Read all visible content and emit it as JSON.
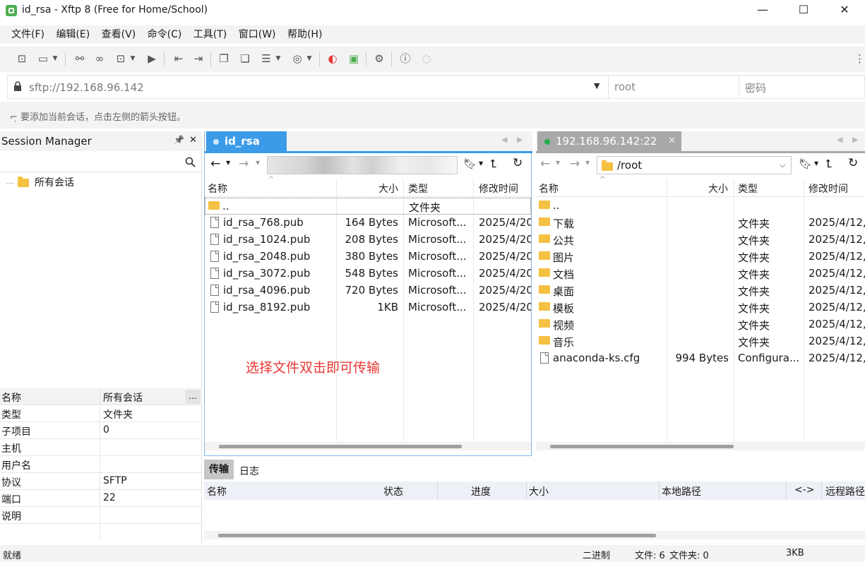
{
  "window": {
    "title": "id_rsa - Xftp 8 (Free for Home/School)",
    "minimize": "—",
    "maximize": "☐",
    "close": "✕"
  },
  "menu": [
    "文件(F)",
    "编辑(E)",
    "查看(V)",
    "命令(C)",
    "工具(T)",
    "窗口(W)",
    "帮助(H)"
  ],
  "address": {
    "url": "sftp://192.168.96.142",
    "user_placeholder": "root",
    "password_placeholder": "密码"
  },
  "hint": "要添加当前会话，点击左侧的箭头按钮。",
  "session_manager": {
    "title": "Session Manager",
    "pin": "📌",
    "close": "✕",
    "tree_root": "所有会话",
    "props_menu": "...",
    "properties": [
      {
        "k": "名称",
        "v": "所有会话"
      },
      {
        "k": "类型",
        "v": "文件夹"
      },
      {
        "k": "子项目",
        "v": "0"
      },
      {
        "k": "主机",
        "v": ""
      },
      {
        "k": "用户名",
        "v": ""
      },
      {
        "k": "协议",
        "v": "SFTP"
      },
      {
        "k": "端口",
        "v": "22"
      },
      {
        "k": "说明",
        "v": ""
      }
    ]
  },
  "local": {
    "tab": "id_rsa",
    "columns": {
      "name": "名称",
      "size": "大小",
      "type": "类型",
      "mtime": "修改时间"
    },
    "parent": {
      "name": "..",
      "type": "文件夹"
    },
    "files": [
      {
        "name": "id_rsa_768.pub",
        "size": "164 Bytes",
        "type": "Microsoft...",
        "mtime": "2025/4/20"
      },
      {
        "name": "id_rsa_1024.pub",
        "size": "208 Bytes",
        "type": "Microsoft...",
        "mtime": "2025/4/20"
      },
      {
        "name": "id_rsa_2048.pub",
        "size": "380 Bytes",
        "type": "Microsoft...",
        "mtime": "2025/4/20"
      },
      {
        "name": "id_rsa_3072.pub",
        "size": "548 Bytes",
        "type": "Microsoft...",
        "mtime": "2025/4/20"
      },
      {
        "name": "id_rsa_4096.pub",
        "size": "720 Bytes",
        "type": "Microsoft...",
        "mtime": "2025/4/20"
      },
      {
        "name": "id_rsa_8192.pub",
        "size": "1KB",
        "type": "Microsoft...",
        "mtime": "2025/4/20"
      }
    ],
    "annotation": "选择文件双击即可传输"
  },
  "remote": {
    "tab": "192.168.96.142:22",
    "path": "/root",
    "columns": {
      "name": "名称",
      "size": "大小",
      "type": "类型",
      "mtime": "修改时间"
    },
    "parent": {
      "name": ".."
    },
    "files": [
      {
        "name": "下载",
        "size": "",
        "type": "文件夹",
        "mtime": "2025/4/12,",
        "kind": "folder"
      },
      {
        "name": "公共",
        "size": "",
        "type": "文件夹",
        "mtime": "2025/4/12,",
        "kind": "folder"
      },
      {
        "name": "图片",
        "size": "",
        "type": "文件夹",
        "mtime": "2025/4/12,",
        "kind": "folder"
      },
      {
        "name": "文档",
        "size": "",
        "type": "文件夹",
        "mtime": "2025/4/12,",
        "kind": "folder"
      },
      {
        "name": "桌面",
        "size": "",
        "type": "文件夹",
        "mtime": "2025/4/12,",
        "kind": "folder"
      },
      {
        "name": "模板",
        "size": "",
        "type": "文件夹",
        "mtime": "2025/4/12,",
        "kind": "folder"
      },
      {
        "name": "视频",
        "size": "",
        "type": "文件夹",
        "mtime": "2025/4/12,",
        "kind": "folder"
      },
      {
        "name": "音乐",
        "size": "",
        "type": "文件夹",
        "mtime": "2025/4/12,",
        "kind": "folder"
      },
      {
        "name": "anaconda-ks.cfg",
        "size": "994 Bytes",
        "type": "Configura...",
        "mtime": "2025/4/12,",
        "kind": "file"
      }
    ]
  },
  "transfer": {
    "tabs": [
      "传输",
      "日志"
    ],
    "columns": [
      "名称",
      "状态",
      "进度",
      "大小",
      "本地路径",
      "<->",
      "远程路径"
    ]
  },
  "status": {
    "left": "就绪",
    "mode": "二进制",
    "files": "文件: 6",
    "folders": "文件夹: 0",
    "size": "3KB"
  },
  "colors": {
    "accent": "#3c9be8",
    "annotation": "#e53935",
    "connected": "#22b04a"
  }
}
